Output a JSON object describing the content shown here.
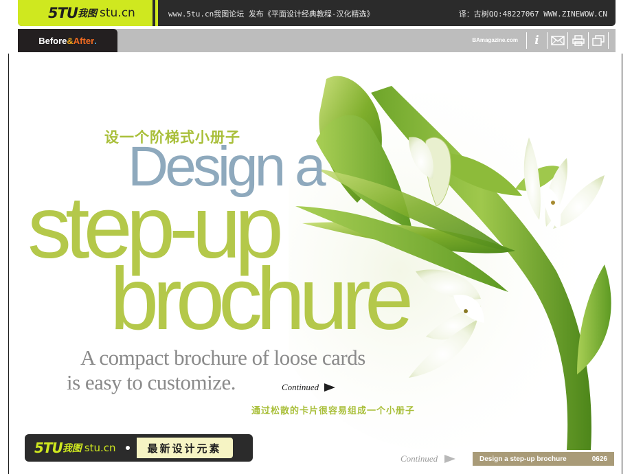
{
  "site": {
    "logo_mark": "5TU",
    "logo_cn": "我图",
    "logo_url": "stu.cn",
    "banner_text": "www.5tu.cn我图论坛 发布《平面设计经典教程-汉化精选》",
    "credit_text": "译：古树QQ:48227067 WWW.ZINEWOW.CN"
  },
  "magazine": {
    "logo_before": "Before",
    "logo_amp": "&",
    "logo_after": "After",
    "logo_dot": ".",
    "site": "BAmagazine.com",
    "icons": [
      "info-icon",
      "mail-icon",
      "print-icon",
      "window-icon"
    ],
    "info_glyph": "i"
  },
  "article": {
    "cn_title": "设一个阶梯式小册子",
    "title_line1": "Design a",
    "title_line2": "step-up",
    "title_line3": "brochure",
    "subtitle_line1": "A compact brochure of loose cards",
    "subtitle_line2": "is easy to customize.",
    "continued": "Continued",
    "cn_subtitle": "通过松散的卡片很容易组成一个小册子"
  },
  "badge": {
    "logo_mark": "5TU",
    "logo_cn": "我图",
    "logo_url": "stu.cn",
    "label": "最新设计元素"
  },
  "footer": {
    "continued": "Continued",
    "article_name": "Design a step-up brochure",
    "page_number": "0626"
  },
  "colors": {
    "accent_lime": "#cfe81f",
    "title_green": "#b4c84a",
    "title_blue": "#8ea9bd",
    "footer_tan": "#a99b78"
  }
}
